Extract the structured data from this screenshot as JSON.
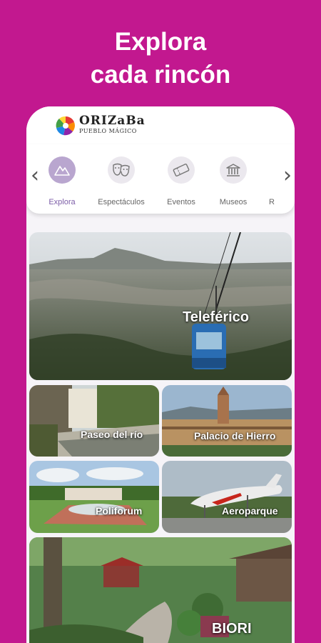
{
  "headline": {
    "line1": "Explora",
    "line2": "cada rincón"
  },
  "brand": {
    "line1": "ORIZaBa",
    "line2": "PUEBLO MÁGICO"
  },
  "categories": [
    {
      "label": "Explora",
      "icon": "mountain-icon",
      "active": true
    },
    {
      "label": "Espectáculos",
      "icon": "theater-masks-icon",
      "active": false
    },
    {
      "label": "Eventos",
      "icon": "ticket-icon",
      "active": false
    },
    {
      "label": "Museos",
      "icon": "museum-icon",
      "active": false
    },
    {
      "label": "R",
      "icon": "",
      "active": false
    }
  ],
  "places": [
    {
      "label": "Teleférico"
    },
    {
      "label": "Paseo del río"
    },
    {
      "label": "Palacio de Hierro"
    },
    {
      "label": "Poliforum"
    },
    {
      "label": "Aeroparque"
    },
    {
      "label": "BIORI"
    }
  ],
  "colors": {
    "background": "#c2188f",
    "accent": "#b9a6cf",
    "accent_text": "#7d5ea8"
  }
}
